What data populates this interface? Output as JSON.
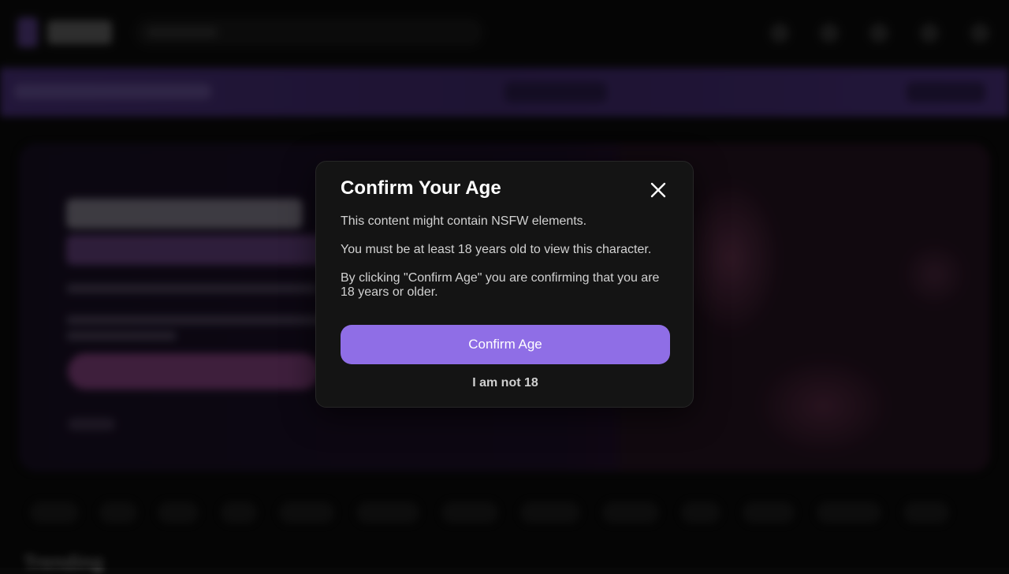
{
  "background": {
    "section_title": "Trending"
  },
  "modal": {
    "title": "Confirm Your Age",
    "close_icon": "close-icon",
    "line1": "This content might contain NSFW elements.",
    "line2": "You must be at least 18 years old to view this character.",
    "line3": "By clicking \"Confirm Age\" you are confirming that you are 18 years or older.",
    "confirm_label": "Confirm Age",
    "decline_label": "I am not 18"
  },
  "colors": {
    "accent": "#8f6ee6",
    "modal_bg": "#141414",
    "promo_bar": "#5b3a9c"
  }
}
